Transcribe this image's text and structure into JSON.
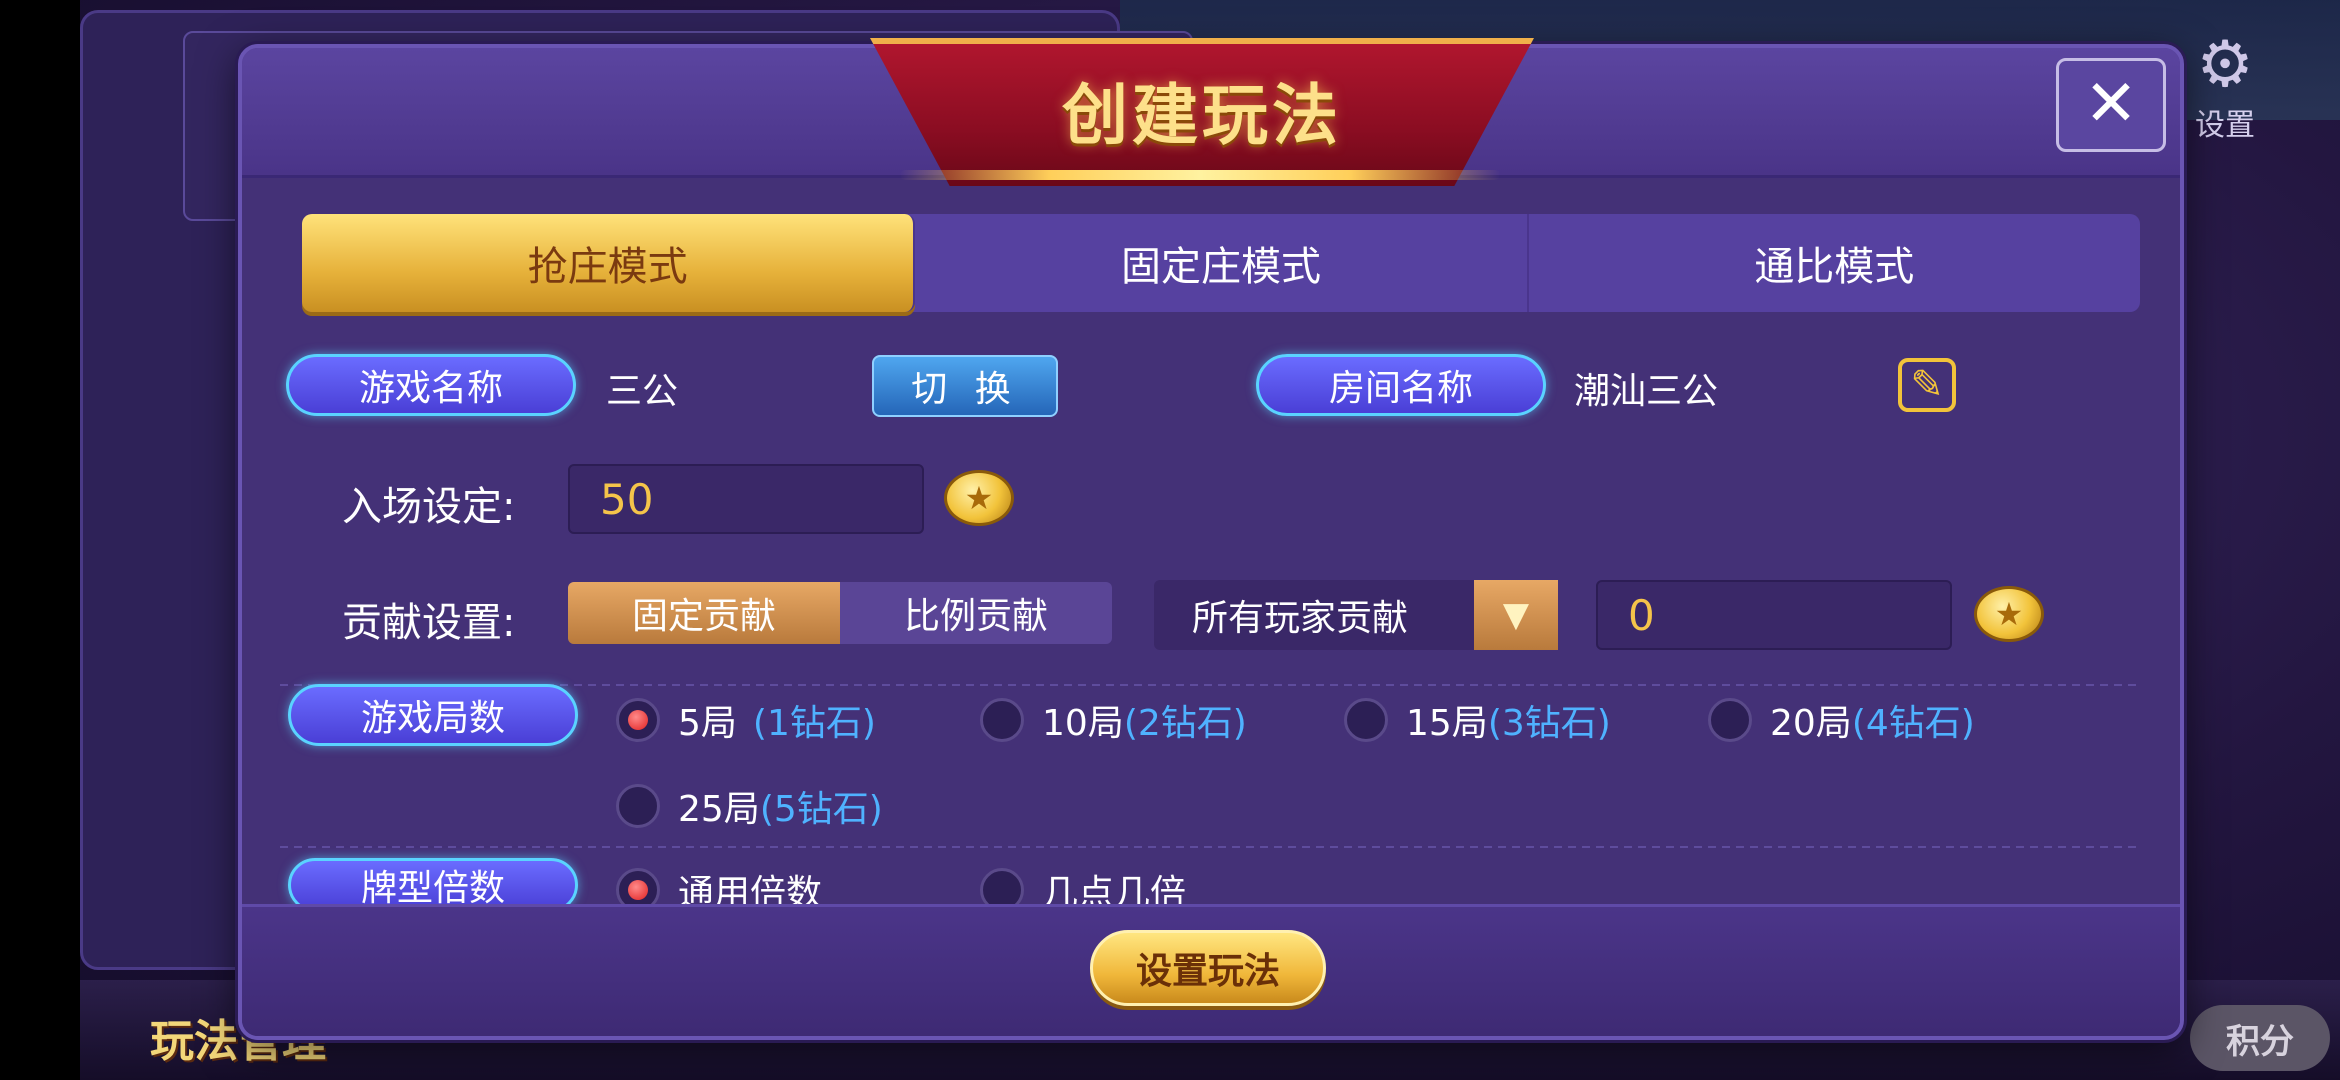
{
  "background": {
    "settings_label": "设置",
    "bottom_left_logo": "玩法管理",
    "bottom_right_button": "积分"
  },
  "dialog": {
    "title": "创建玩法",
    "close_symbol": "✕",
    "tabs": [
      {
        "label": "抢庄模式",
        "active": true
      },
      {
        "label": "固定庄模式",
        "active": false
      },
      {
        "label": "通比模式",
        "active": false
      }
    ],
    "game_name": {
      "label": "游戏名称",
      "value": "三公",
      "switch_label": "切 换"
    },
    "room_name": {
      "label": "房间名称",
      "value": "潮汕三公"
    },
    "entry": {
      "label": "入场设定:",
      "value": "50"
    },
    "contribution": {
      "label": "贡献设置:",
      "options": [
        "固定贡献",
        "比例贡献"
      ],
      "selected": "固定贡献",
      "dropdown_value": "所有玩家贡献",
      "amount": "0"
    },
    "rounds": {
      "label": "游戏局数",
      "options": [
        {
          "main": "5局",
          "sub": "(1钻石)",
          "selected": true
        },
        {
          "main": "10局",
          "sub": "(2钻石)",
          "selected": false
        },
        {
          "main": "15局",
          "sub": "(3钻石)",
          "selected": false
        },
        {
          "main": "20局",
          "sub": "(4钻石)",
          "selected": false
        },
        {
          "main": "25局",
          "sub": "(5钻石)",
          "selected": false
        }
      ]
    },
    "multiplier": {
      "label": "牌型倍数",
      "options": [
        {
          "label": "通用倍数",
          "selected": true
        },
        {
          "label": "几点几倍",
          "selected": false
        }
      ]
    },
    "submit_label": "设置玩法"
  },
  "colors": {
    "dialog_bg": "#443177",
    "accent_gold": "#f2c33a",
    "accent_blue": "#5ad3ff",
    "title_red": "#b0162e"
  }
}
